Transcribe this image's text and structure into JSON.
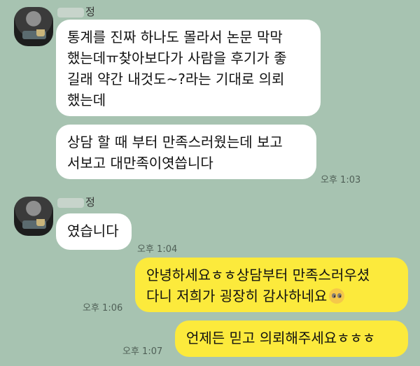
{
  "messages": {
    "group1": {
      "sender_name": "정",
      "bubble1": {
        "lines": [
          "통계를 진짜 하나도 몰라서 논문 막막",
          "했는데ㅠ찾아보다가 사람을 후기가 좋",
          "길래 약간 내것도~?라는 기대로 의뢰",
          "했는데"
        ]
      },
      "bubble2": {
        "lines": [
          "상담 할 때 부터 만족스러웠는데 보고",
          "서보고 대만족이엿씁니다"
        ],
        "time": "오후 1:03"
      }
    },
    "group2": {
      "sender_name": "정",
      "bubble1": {
        "text": "였습니다",
        "time": "오후 1:04"
      }
    },
    "outgoing": [
      {
        "lines": [
          "안녕하세요ㅎㅎ상담부터 만족스러우셨",
          "다니 저희가 굉장히 감사하네요"
        ],
        "emoji": "pleading-face-icon",
        "time": "오후 1:06"
      },
      {
        "text": "언제든 믿고 의뢰해주세요ㅎㅎㅎ",
        "time": "오후 1:07"
      }
    ]
  },
  "colors": {
    "background": "#a7c3b1",
    "incoming_bubble": "#ffffff",
    "outgoing_bubble": "#fcea3c"
  }
}
